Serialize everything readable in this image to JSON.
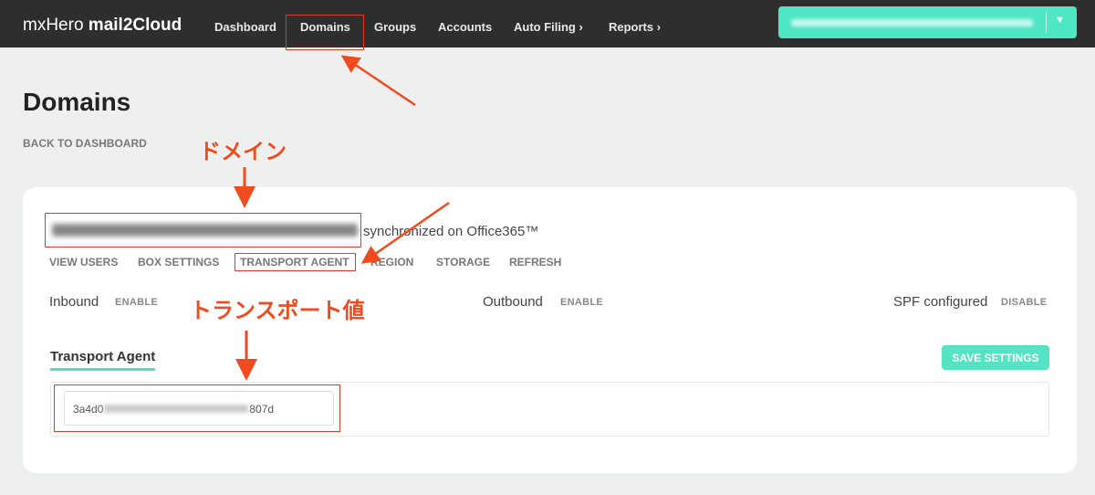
{
  "nav": {
    "brand_light": "mxHero",
    "brand_bold": "mail2Cloud",
    "items": [
      "Dashboard",
      "Domains",
      "Groups",
      "Accounts",
      "Auto Filing ›",
      "Reports ›"
    ]
  },
  "page": {
    "title": "Domains",
    "back_link": "BACK TO DASHBOARD"
  },
  "domain": {
    "sync_status": "synchronized on Office365™",
    "tabs": [
      "VIEW USERS",
      "BOX SETTINGS",
      "TRANSPORT AGENT",
      "REGION",
      "STORAGE",
      "REFRESH"
    ]
  },
  "settings": {
    "inbound_label": "Inbound",
    "inbound_action": "ENABLE",
    "outbound_label": "Outbound",
    "outbound_action": "ENABLE",
    "spf_label": "SPF configured",
    "spf_action": "DISABLE"
  },
  "transport": {
    "heading": "Transport Agent",
    "save_label": "SAVE SETTINGS",
    "value_start": "3a4d0",
    "value_end": "807d"
  },
  "annotations": {
    "domain_note": "ドメイン",
    "transport_note": "トランスポート値"
  },
  "colors": {
    "accent": "#4fe6c6",
    "nav_bg": "#2e2e2e",
    "annotation": "#e03a2a"
  }
}
